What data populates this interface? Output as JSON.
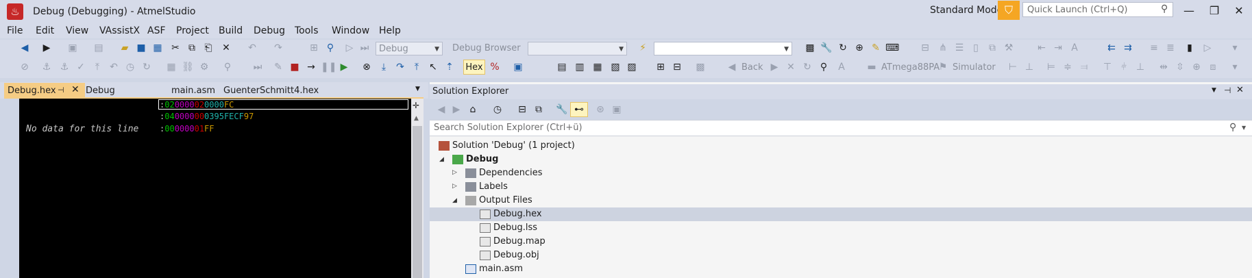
{
  "window": {
    "title": "Debug (Debugging) - AtmelStudio",
    "mode": "Standard Mode",
    "quick_launch_placeholder": "Quick Launch (Ctrl+Q)"
  },
  "menu": [
    "File",
    "Edit",
    "View",
    "VAssistX",
    "ASF",
    "Project",
    "Build",
    "Debug",
    "Tools",
    "Window",
    "Help"
  ],
  "toolbar1": {
    "config_combo": "Debug",
    "debug_browser": "Debug Browser"
  },
  "toolbar2": {
    "hex_label": "Hex",
    "back_label": "Back",
    "device_label": "ATmega88PA",
    "tool_label": "Simulator"
  },
  "tabs": [
    {
      "label": "Debug.hex",
      "active": true
    },
    {
      "label": "Debug",
      "active": false
    },
    {
      "label": "main.asm",
      "active": false
    },
    {
      "label": "GuenterSchmitt4.hex",
      "active": false
    }
  ],
  "editor": {
    "no_data_text": "No data for this line",
    "hex_lines": [
      {
        "colon": ":",
        "count": "02",
        "addr": "0000",
        "type": "02",
        "data": "0000",
        "checksum": "FC"
      },
      {
        "colon": ":",
        "count": "04",
        "addr": "0000",
        "type": "00",
        "data": "0395FECF",
        "checksum": "97"
      },
      {
        "colon": ":",
        "count": "00",
        "addr": "0000",
        "type": "01",
        "data": "",
        "checksum": "FF"
      }
    ]
  },
  "solution_explorer": {
    "title": "Solution Explorer",
    "search_placeholder": "Search Solution Explorer (Ctrl+ü)",
    "tree": {
      "solution": "Solution 'Debug' (1 project)",
      "project": "Debug",
      "dependencies": "Dependencies",
      "labels": "Labels",
      "output_files": "Output Files",
      "files": [
        "Debug.hex",
        "Debug.lss",
        "Debug.map",
        "Debug.obj"
      ],
      "main": "main.asm"
    }
  },
  "colors": {
    "accent_orange": "#f5a623",
    "tab_active": "#f5cc84",
    "hex_count": "#00c000",
    "hex_addr": "#c000c0",
    "hex_type": "#cc0000",
    "hex_data": "#20b2aa",
    "hex_checksum": "#cc9900"
  }
}
